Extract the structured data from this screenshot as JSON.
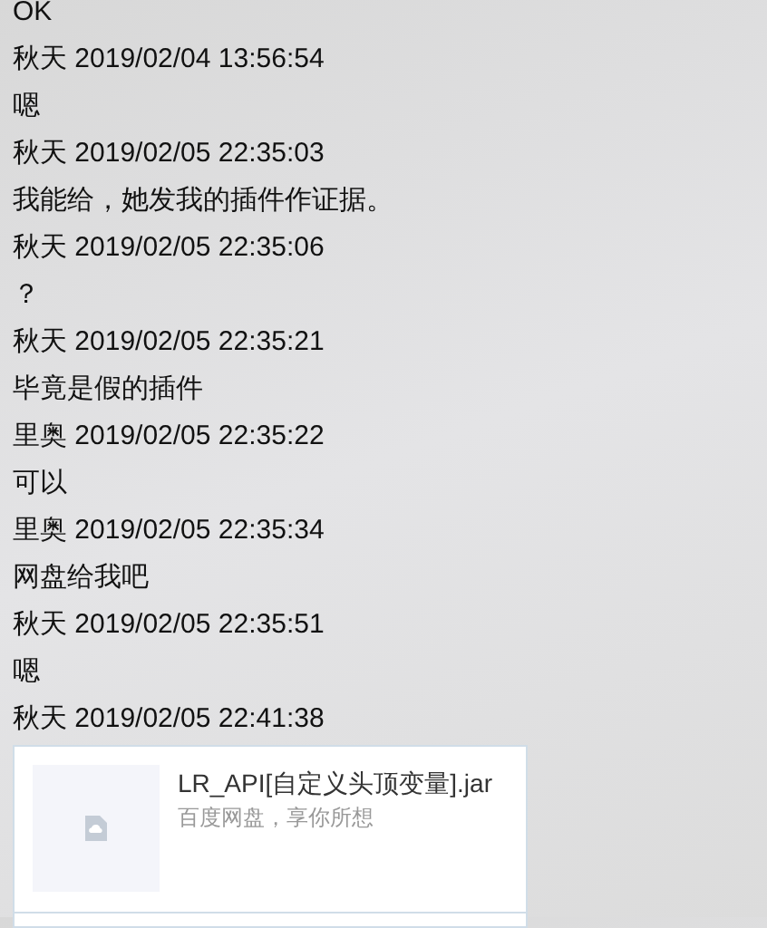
{
  "messages": [
    {
      "kind": "text",
      "text": "OK"
    },
    {
      "kind": "header",
      "text": "秋天 2019/02/04 13:56:54"
    },
    {
      "kind": "text",
      "text": "嗯"
    },
    {
      "kind": "header",
      "text": "秋天 2019/02/05 22:35:03"
    },
    {
      "kind": "text",
      "text": "我能给，她发我的插件作证据。"
    },
    {
      "kind": "header",
      "text": "秋天 2019/02/05 22:35:06"
    },
    {
      "kind": "text",
      "text": "？"
    },
    {
      "kind": "header",
      "text": "秋天 2019/02/05 22:35:21"
    },
    {
      "kind": "text",
      "text": "毕竟是假的插件"
    },
    {
      "kind": "header",
      "text": "里奥 2019/02/05 22:35:22"
    },
    {
      "kind": "text",
      "text": "可以"
    },
    {
      "kind": "header",
      "text": "里奥 2019/02/05 22:35:34"
    },
    {
      "kind": "text",
      "text": "网盘给我吧"
    },
    {
      "kind": "header",
      "text": "秋天 2019/02/05 22:35:51"
    },
    {
      "kind": "text",
      "text": "嗯"
    },
    {
      "kind": "header",
      "text": "秋天 2019/02/05 22:41:38"
    },
    {
      "kind": "file_card",
      "title": "LR_API[自定义头顶变量].jar",
      "subtitle": "百度网盘，享你所想"
    }
  ]
}
